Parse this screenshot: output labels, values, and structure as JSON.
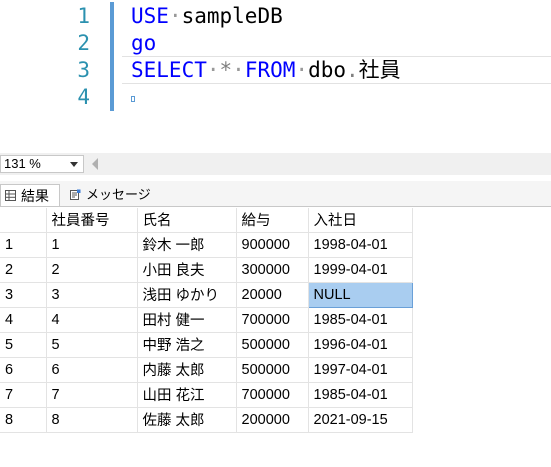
{
  "editor": {
    "line_numbers": [
      "1",
      "2",
      "3",
      "4"
    ],
    "line1": {
      "keyword": "USE",
      "name": "sampleDB"
    },
    "line2": {
      "keyword": "go"
    },
    "line3": {
      "keyword1": "SELECT",
      "star": "*",
      "keyword2": "FROM",
      "schema": "dbo",
      "table": "社員"
    }
  },
  "zoom": {
    "value": "131 %"
  },
  "tabs": {
    "results": "結果",
    "messages": "メッセージ"
  },
  "grid": {
    "columns": [
      "",
      "社員番号",
      "氏名",
      "給与",
      "入社日"
    ],
    "rows": [
      [
        "1",
        "1",
        "鈴木 一郎",
        "900000",
        "1998-04-01"
      ],
      [
        "2",
        "2",
        "小田 良夫",
        "300000",
        "1999-04-01"
      ],
      [
        "3",
        "3",
        "浅田 ゆかり",
        "20000",
        "NULL"
      ],
      [
        "4",
        "4",
        "田村 健一",
        "700000",
        "1985-04-01"
      ],
      [
        "5",
        "5",
        "中野 浩之",
        "500000",
        "1996-04-01"
      ],
      [
        "6",
        "6",
        "内藤 太郎",
        "500000",
        "1997-04-01"
      ],
      [
        "7",
        "7",
        "山田 花江",
        "700000",
        "1985-04-01"
      ],
      [
        "8",
        "8",
        "佐藤 太郎",
        "200000",
        "2021-09-15"
      ]
    ]
  },
  "colors": {
    "keyword": "#0000ff",
    "line_number": "#2b91af",
    "selection": "#a9cdf0"
  }
}
